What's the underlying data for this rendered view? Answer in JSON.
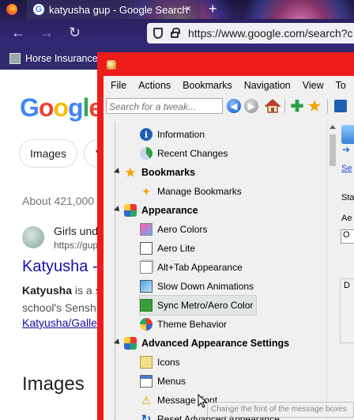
{
  "browser": {
    "tab_title": "katyusha gup - Google Search",
    "tab_close": "×",
    "new_tab": "+",
    "url": "https://www.google.com/search?c",
    "bookmark_label": "Horse Insurance -",
    "nav_back": "←",
    "nav_forward": "→",
    "nav_reload": "↻"
  },
  "google": {
    "logo": [
      "G",
      "o",
      "o",
      "g",
      "l",
      "e"
    ],
    "chip_images": "Images",
    "chip_partial": "V",
    "about": "About 421,000",
    "result_site_name": "Girls und",
    "result_site_url": "https://gup",
    "result_title": "Katyusha -",
    "result_snippet_bold": "Katyusha",
    "result_snippet_rest": " is a s",
    "result_snippet_line2": "school's Sensh",
    "result_link": "Katyusha/Galle",
    "images_heading": "Images"
  },
  "tweaker": {
    "menu": [
      "File",
      "Actions",
      "Bookmarks",
      "Navigation",
      "View",
      "To"
    ],
    "search_placeholder": "Search for a tweak...",
    "tree": [
      {
        "label": "Information",
        "icon": "info-icon",
        "type": "item"
      },
      {
        "label": "Recent Changes",
        "icon": "recent-changes-icon",
        "type": "item"
      },
      {
        "label": "Bookmarks",
        "icon": "star-icon",
        "type": "category"
      },
      {
        "label": "Manage Bookmarks",
        "icon": "manage-bookmarks-icon",
        "type": "item"
      },
      {
        "label": "Appearance",
        "icon": "appearance-icon",
        "type": "category"
      },
      {
        "label": "Aero Colors",
        "icon": "aero-colors-icon",
        "type": "item"
      },
      {
        "label": "Aero Lite",
        "icon": "aero-lite-icon",
        "type": "item"
      },
      {
        "label": "Alt+Tab Appearance",
        "icon": "alt-tab-icon",
        "type": "item"
      },
      {
        "label": "Slow Down Animations",
        "icon": "slow-animations-icon",
        "type": "item"
      },
      {
        "label": "Sync Metro/Aero Color",
        "icon": "sync-color-icon",
        "type": "item",
        "selected": true
      },
      {
        "label": "Theme Behavior",
        "icon": "theme-behavior-icon",
        "type": "item"
      },
      {
        "label": "Advanced Appearance Settings",
        "icon": "advanced-appearance-icon",
        "type": "category"
      },
      {
        "label": "Icons",
        "icon": "icons-icon",
        "type": "item"
      },
      {
        "label": "Menus",
        "icon": "menus-icon",
        "type": "item"
      },
      {
        "label": "Message Font",
        "icon": "warning-icon",
        "type": "item"
      },
      {
        "label": "Reset Advanced Appearance",
        "icon": "reset-icon",
        "type": "item"
      }
    ],
    "right_panel": {
      "link": "Se",
      "label1": "Sta",
      "label2": "Ae",
      "box": "O",
      "label3": "D"
    },
    "tooltip": "Change the font of the message boxes"
  },
  "colors": {
    "window_border": "#ee1b1b",
    "google_link": "#1a0dab",
    "browser_toolbar": "#33287a"
  }
}
